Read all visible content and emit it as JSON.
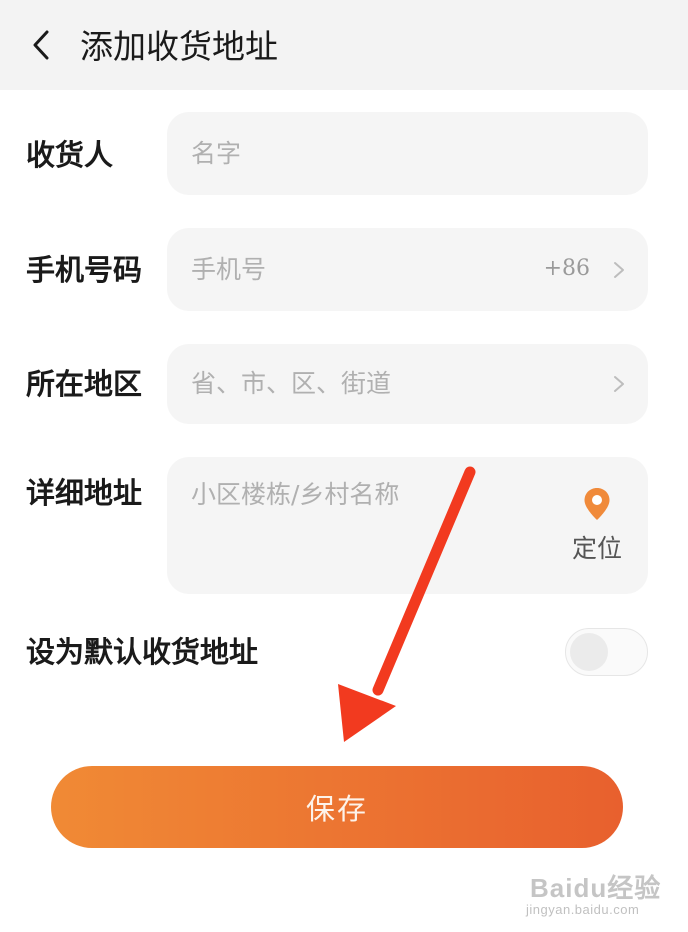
{
  "header": {
    "title": "添加收货地址",
    "back_icon": "chevron-left-icon"
  },
  "form": {
    "recipient": {
      "label": "收货人",
      "placeholder": "名字"
    },
    "phone": {
      "label": "手机号码",
      "placeholder": "手机号",
      "country_code": "+86"
    },
    "region": {
      "label": "所在地区",
      "placeholder": "省、市、区、街道"
    },
    "address": {
      "label": "详细地址",
      "placeholder": "小区楼栋/乡村名称",
      "locate_label": "定位",
      "locate_icon": "location-pin-icon"
    },
    "default": {
      "label": "设为默认收货地址",
      "enabled": false
    }
  },
  "actions": {
    "save_label": "保存"
  },
  "watermark": {
    "brand": "Baidu经验",
    "url": "jingyan.baidu.com"
  },
  "colors": {
    "header_bg": "#f3f3f3",
    "field_bg": "#f5f5f5",
    "accent_start": "#f08a35",
    "accent_end": "#e8602e",
    "annotation_arrow": "#f23a1f",
    "locate_pin": "#f08a3a"
  }
}
